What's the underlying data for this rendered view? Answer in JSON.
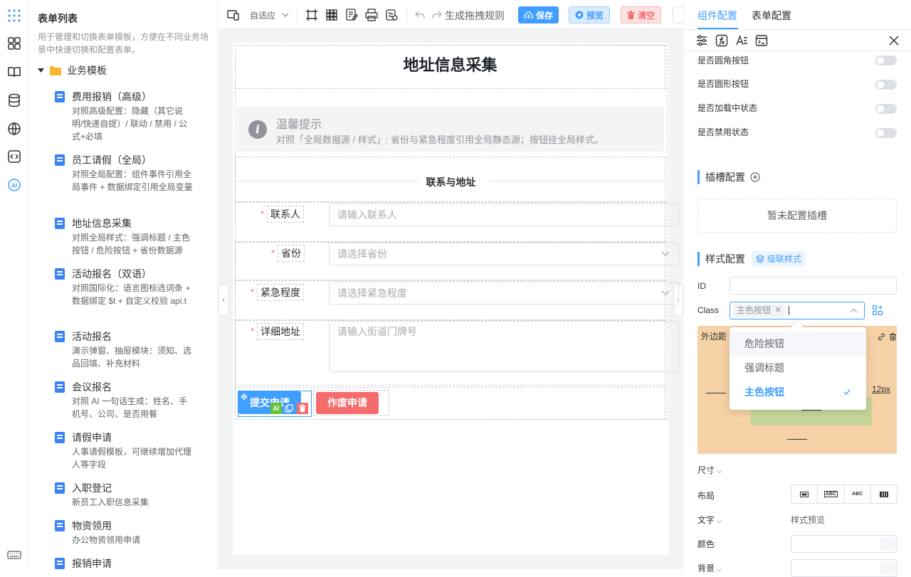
{
  "sidebar": {
    "title": "表单列表",
    "desc": "用于管理和切换表单模板，方便在不同业务场景中快速切换和配置表单。",
    "group": "业务模板",
    "items": [
      {
        "title": "费用报销（高级）",
        "desc": "对照高级配置：隐藏（其它说明/快递自提）/ 联动 / 禁用 / 公式+必填"
      },
      {
        "title": "员工请假（全局）",
        "desc": "对照全局配置：组件事件引用全局事件 + 数据绑定引用全局变量"
      },
      {
        "title": "地址信息采集",
        "desc": "对照全局样式：强调标题 / 主色按钮 / 危险按钮 + 省份数据源"
      },
      {
        "title": "活动报名（双语）",
        "desc": "对照国际化：语言图标选词条 + 数据绑定 $t + 自定义校验 api.t"
      },
      {
        "title": "活动报名",
        "desc": "演示弹窗、抽屉模块：须知、选品回填、补充材料"
      },
      {
        "title": "会议报名",
        "desc": "对照 AI 一句话生成：姓名、手机号、公司、是否用餐"
      },
      {
        "title": "请假申请",
        "desc": "人事请假模板，可继续增加代理人等字段"
      },
      {
        "title": "入职登记",
        "desc": "新员工入职信息采集"
      },
      {
        "title": "物资领用",
        "desc": "办公物资领用申请"
      },
      {
        "title": "报销申请",
        "desc": ""
      }
    ]
  },
  "toolbar": {
    "adapt": "自适应",
    "drag_rule": "生成拖拽规则",
    "save": "保存",
    "preview": "预览",
    "clear": "清空"
  },
  "form": {
    "title": "地址信息采集",
    "alert_title": "温馨提示",
    "alert_desc": "对照「全局数据源 / 样式」: 省份与紧急程度引用全局静态源；按钮挂全局样式。",
    "divider": "联系与地址",
    "fields": [
      {
        "label": "联系人",
        "placeholder": "请输入联系人"
      },
      {
        "label": "省份",
        "placeholder": "请选择省份"
      },
      {
        "label": "紧急程度",
        "placeholder": "请选择紧急程度"
      },
      {
        "label": "详细地址",
        "placeholder": "请输入街道门牌号"
      }
    ],
    "submit": "提交申请",
    "void": "作废申请",
    "ai_badge": "AI"
  },
  "panel": {
    "tab_component": "组件配置",
    "tab_form": "表单配置",
    "toggles": [
      "是否圆角按钮",
      "是否圆形按钮",
      "是否加载中状态",
      "是否禁用状态"
    ],
    "slot_title": "插槽配置",
    "slot_empty": "暂未配置插槽",
    "style_title": "样式配置",
    "cascade": "级联样式",
    "id_label": "ID",
    "class_label": "Class",
    "class_tag": "主色按钮",
    "margin_label": "外边距",
    "margin_value": "12px",
    "options": [
      "危险按钮",
      "强调标题",
      "主色按钮"
    ],
    "size_label": "尺寸",
    "layout_label": "布局",
    "layout_options": [
      "ABC",
      "ABC"
    ],
    "text_label": "文字",
    "text_preview": "样式预览",
    "color_label": "颜色",
    "bg_label": "背景"
  },
  "colors": {
    "primary": "#409eff",
    "danger": "#f56c6c",
    "rail_ai": "#409eff"
  }
}
